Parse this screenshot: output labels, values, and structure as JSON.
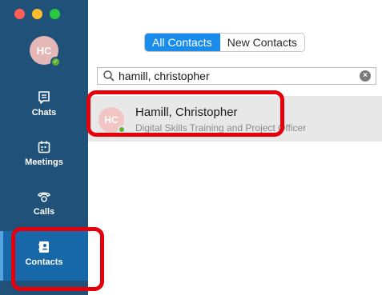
{
  "user": {
    "initials": "HC",
    "status": "available"
  },
  "nav": {
    "chats": "Chats",
    "meetings": "Meetings",
    "calls": "Calls",
    "contacts": "Contacts"
  },
  "tabs": {
    "all_contacts": "All Contacts",
    "new_contacts": "New Contacts"
  },
  "search": {
    "value": "hamill, christopher"
  },
  "result": {
    "initials": "HC",
    "name": "Hamill, Christopher",
    "title": "Digital Skills Training and Project Officer"
  },
  "colors": {
    "sidebar": "#1f5179",
    "active_nav": "#1668a8",
    "accent": "#1a8ceb",
    "highlight": "#e3000b",
    "presence": "#5fb230"
  }
}
